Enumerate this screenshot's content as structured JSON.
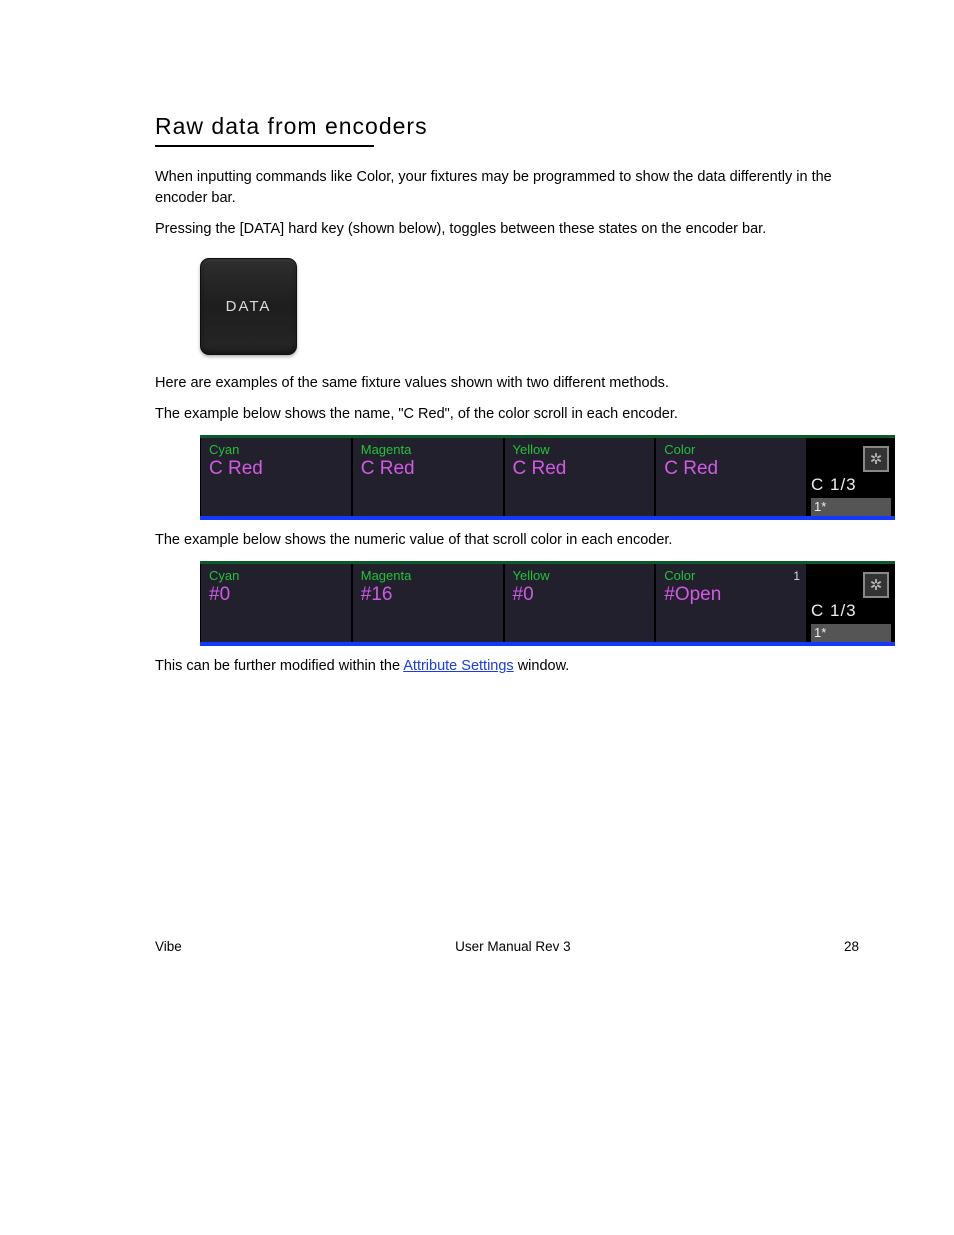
{
  "heading": "Raw data from encoders",
  "intro": [
    "When inputting commands like Color, your fixtures may be programmed to show the data differently in the encoder bar.",
    "Pressing the [DATA] hard key (shown below), toggles between these states on the encoder bar."
  ],
  "data_key": {
    "label": "DATA"
  },
  "examples_intro": "Here are examples of the same fixture values shown with two different methods.",
  "example1_caption": "The example below shows the name, \"C Red\", of the color scroll in each encoder.",
  "bar1": {
    "cells": [
      {
        "label": "Cyan",
        "value": "C Red"
      },
      {
        "label": "Magenta",
        "value": "C Red"
      },
      {
        "label": "Yellow",
        "value": "C Red"
      },
      {
        "label": "Color",
        "value": "C Red"
      }
    ],
    "page": "C 1/3",
    "foot": "1*"
  },
  "example2_caption": "The example below shows the numeric value of that scroll color in each encoder.",
  "bar2": {
    "cells": [
      {
        "label": "Cyan",
        "value": "#0"
      },
      {
        "label": "Magenta",
        "value": "#16"
      },
      {
        "label": "Yellow",
        "value": "#0"
      },
      {
        "label": "Color",
        "value": "#Open",
        "num": "1"
      }
    ],
    "page": "C 1/3",
    "foot": "1*"
  },
  "afterword": {
    "pre": "This can be further modified within the ",
    "link": "Attribute Settings",
    "post": " window."
  },
  "footer": {
    "product": "Vibe",
    "manual": "User Manual Rev 3",
    "page": "28"
  }
}
